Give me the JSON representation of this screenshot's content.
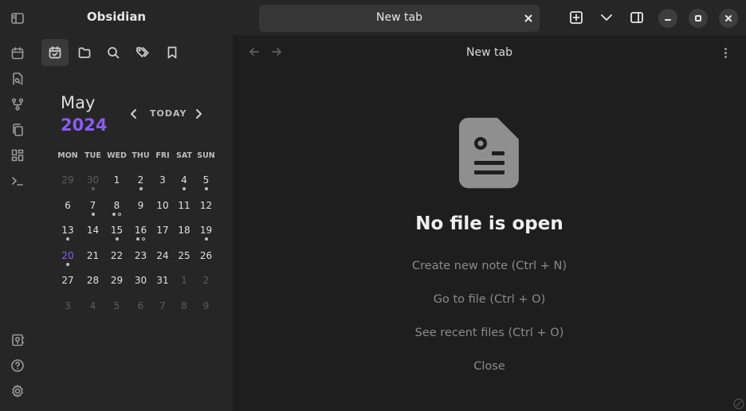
{
  "app": {
    "title": "Obsidian"
  },
  "ribbon": {
    "top_icons": [
      "sidebar-toggle-icon",
      "calendar-icon",
      "file-search-icon",
      "graph-icon",
      "copy-icon",
      "dashboard-icon",
      "terminal-icon"
    ],
    "bottom_icons": [
      "vault-icon",
      "help-icon",
      "settings-icon"
    ]
  },
  "sidebar": {
    "tabs": [
      "calendar-check-icon",
      "folder-icon",
      "search-icon",
      "tags-icon",
      "bookmark-icon"
    ],
    "active_tab": 0
  },
  "calendar": {
    "month": "May",
    "year": "2024",
    "today_label": "TODAY",
    "weekdays": [
      "MON",
      "TUE",
      "WED",
      "THU",
      "FRI",
      "SAT",
      "SUN"
    ],
    "weeks": [
      [
        {
          "d": "29",
          "other": true
        },
        {
          "d": "30",
          "other": true,
          "dots": [
            "filled"
          ]
        },
        {
          "d": "1"
        },
        {
          "d": "2",
          "dots": [
            "filled"
          ]
        },
        {
          "d": "3"
        },
        {
          "d": "4",
          "dots": [
            "filled"
          ]
        },
        {
          "d": "5",
          "dots": [
            "filled"
          ]
        }
      ],
      [
        {
          "d": "6"
        },
        {
          "d": "7",
          "dots": [
            "filled"
          ]
        },
        {
          "d": "8",
          "dots": [
            "filled",
            "hollow"
          ]
        },
        {
          "d": "9"
        },
        {
          "d": "10"
        },
        {
          "d": "11"
        },
        {
          "d": "12"
        }
      ],
      [
        {
          "d": "13",
          "dots": [
            "filled"
          ]
        },
        {
          "d": "14"
        },
        {
          "d": "15",
          "dots": [
            "filled"
          ]
        },
        {
          "d": "16",
          "dots": [
            "filled",
            "hollow"
          ]
        },
        {
          "d": "17"
        },
        {
          "d": "18"
        },
        {
          "d": "19",
          "dots": [
            "filled"
          ]
        }
      ],
      [
        {
          "d": "20",
          "today": true,
          "dots": [
            "filled"
          ]
        },
        {
          "d": "21"
        },
        {
          "d": "22"
        },
        {
          "d": "23"
        },
        {
          "d": "24"
        },
        {
          "d": "25"
        },
        {
          "d": "26"
        }
      ],
      [
        {
          "d": "27"
        },
        {
          "d": "28"
        },
        {
          "d": "29"
        },
        {
          "d": "30"
        },
        {
          "d": "31"
        },
        {
          "d": "1",
          "other": true
        },
        {
          "d": "2",
          "other": true
        }
      ],
      [
        {
          "d": "3",
          "other": true
        },
        {
          "d": "4",
          "other": true
        },
        {
          "d": "5",
          "other": true
        },
        {
          "d": "6",
          "other": true
        },
        {
          "d": "7",
          "other": true
        },
        {
          "d": "8",
          "other": true
        },
        {
          "d": "9",
          "other": true
        }
      ]
    ]
  },
  "tab": {
    "title": "New tab"
  },
  "view": {
    "title": "New tab",
    "empty_title": "No file is open",
    "actions": [
      "Create new note (Ctrl + N)",
      "Go to file (Ctrl + O)",
      "See recent files (Ctrl + O)",
      "Close"
    ]
  },
  "colors": {
    "accent": "#8a5cf5",
    "background": "#1e1e1e",
    "sidebar": "#262626"
  }
}
